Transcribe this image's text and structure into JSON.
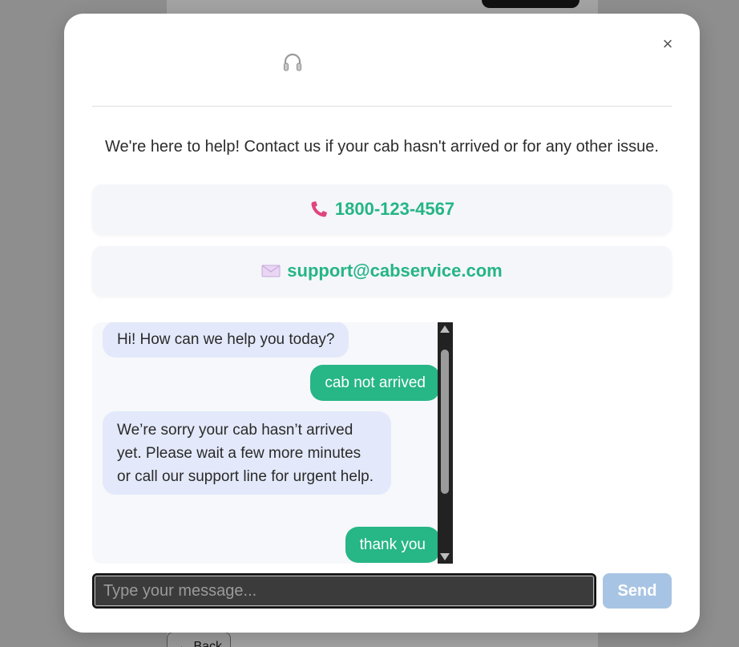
{
  "background": {
    "back_label": "← Back"
  },
  "modal": {
    "close_label": "×",
    "header_icon": "headset-icon",
    "help_text": "We're here to help! Contact us if your cab hasn't arrived or for any other issue.",
    "phone": {
      "icon": "phone-icon",
      "value": "1800-123-4567"
    },
    "email": {
      "icon": "envelope-icon",
      "value": "support@cabservice.com"
    },
    "chat": {
      "messages": [
        {
          "from": "bot",
          "text": "Hi! How can we help you today?"
        },
        {
          "from": "user",
          "text": "cab not arrived"
        },
        {
          "from": "bot",
          "text": "We’re sorry your cab hasn’t arrived yet. Please wait a few more minutes or call our support line for urgent help."
        },
        {
          "from": "user",
          "text": "thank you"
        }
      ]
    },
    "input": {
      "placeholder": "Type your message...",
      "value": ""
    },
    "send_label": "Send"
  },
  "colors": {
    "accent_green": "#27b685",
    "bot_bubble": "#e3e9fa",
    "send_disabled": "#a8c4e4",
    "overlay": "#8e8e8e"
  }
}
